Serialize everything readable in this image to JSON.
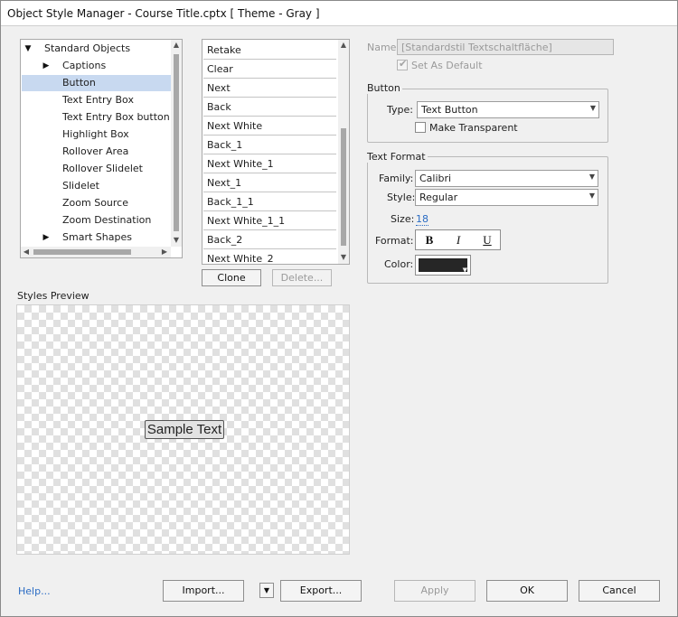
{
  "window": {
    "title": "Object Style Manager - Course Title.cptx [ Theme - Gray ]"
  },
  "tree": {
    "items": [
      {
        "label": "Standard Objects",
        "expanded": true,
        "selected": false
      },
      {
        "label": "Captions",
        "expanded": false,
        "selected": false
      },
      {
        "label": "Button",
        "selected": true
      },
      {
        "label": "Text Entry Box",
        "selected": false
      },
      {
        "label": "Text Entry Box button",
        "selected": false
      },
      {
        "label": "Highlight Box",
        "selected": false
      },
      {
        "label": "Rollover Area",
        "selected": false
      },
      {
        "label": "Rollover Slidelet",
        "selected": false
      },
      {
        "label": "Slidelet",
        "selected": false
      },
      {
        "label": "Zoom Source",
        "selected": false
      },
      {
        "label": "Zoom Destination",
        "selected": false
      },
      {
        "label": "Smart Shapes",
        "expanded": false,
        "selected": false
      }
    ]
  },
  "styles_list": {
    "items": [
      "Retake",
      "Clear",
      "Next",
      "Back",
      "Next White",
      "Back_1",
      "Next White_1",
      "Next_1",
      "Back_1_1",
      "Next White_1_1",
      "Back_2",
      "Next White_2"
    ]
  },
  "list_buttons": {
    "clone": "Clone",
    "delete": "Delete..."
  },
  "name_field": {
    "label": "Name",
    "value": "[Standardstil Textschaltfläche]"
  },
  "set_default": {
    "label": "Set As Default",
    "checked": true,
    "enabled": false
  },
  "button_group": {
    "title": "Button",
    "type_label": "Type:",
    "type_value": "Text Button",
    "transparent_label": "Make Transparent",
    "transparent_checked": false
  },
  "text_format": {
    "title": "Text Format",
    "family_label": "Family:",
    "family_value": "Calibri",
    "style_label": "Style:",
    "style_value": "Regular",
    "size_label": "Size:",
    "size_value": "18",
    "format_label": "Format:",
    "bold": "B",
    "italic": "I",
    "underline": "U",
    "color_label": "Color:",
    "color_value": "#262626"
  },
  "preview": {
    "label": "Styles Preview",
    "sample_text": "Sample Text"
  },
  "footer": {
    "help": "Help...",
    "import": "Import...",
    "export": "Export...",
    "apply": "Apply",
    "ok": "OK",
    "cancel": "Cancel"
  },
  "colors": {
    "selection": "#c8d9f0",
    "link": "#2b6cc4"
  }
}
